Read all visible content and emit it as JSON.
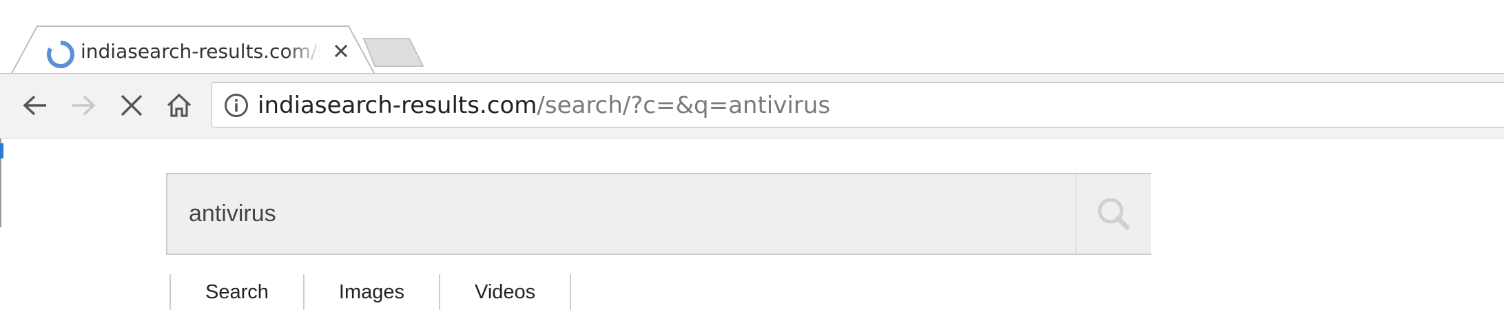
{
  "browser": {
    "tab": {
      "title": "indiasearch-results.com/search/?c=&q=antivirus",
      "loading": true,
      "spinner_color": "#5b8fd8"
    },
    "toolbar": {
      "back_icon": "arrow-left-icon",
      "forward_icon": "arrow-right-icon",
      "stop_icon": "close-icon",
      "home_icon": "home-icon",
      "forward_enabled": false
    },
    "omnibox": {
      "info_icon": "info-circle-icon",
      "host": "indiasearch-results.com",
      "path": "/search/?c=&q=antivirus"
    }
  },
  "page": {
    "search": {
      "query": "antivirus",
      "button_icon": "magnifier-icon"
    },
    "vertical_tabs": [
      {
        "label": "Search"
      },
      {
        "label": "Images"
      },
      {
        "label": "Videos"
      }
    ]
  }
}
